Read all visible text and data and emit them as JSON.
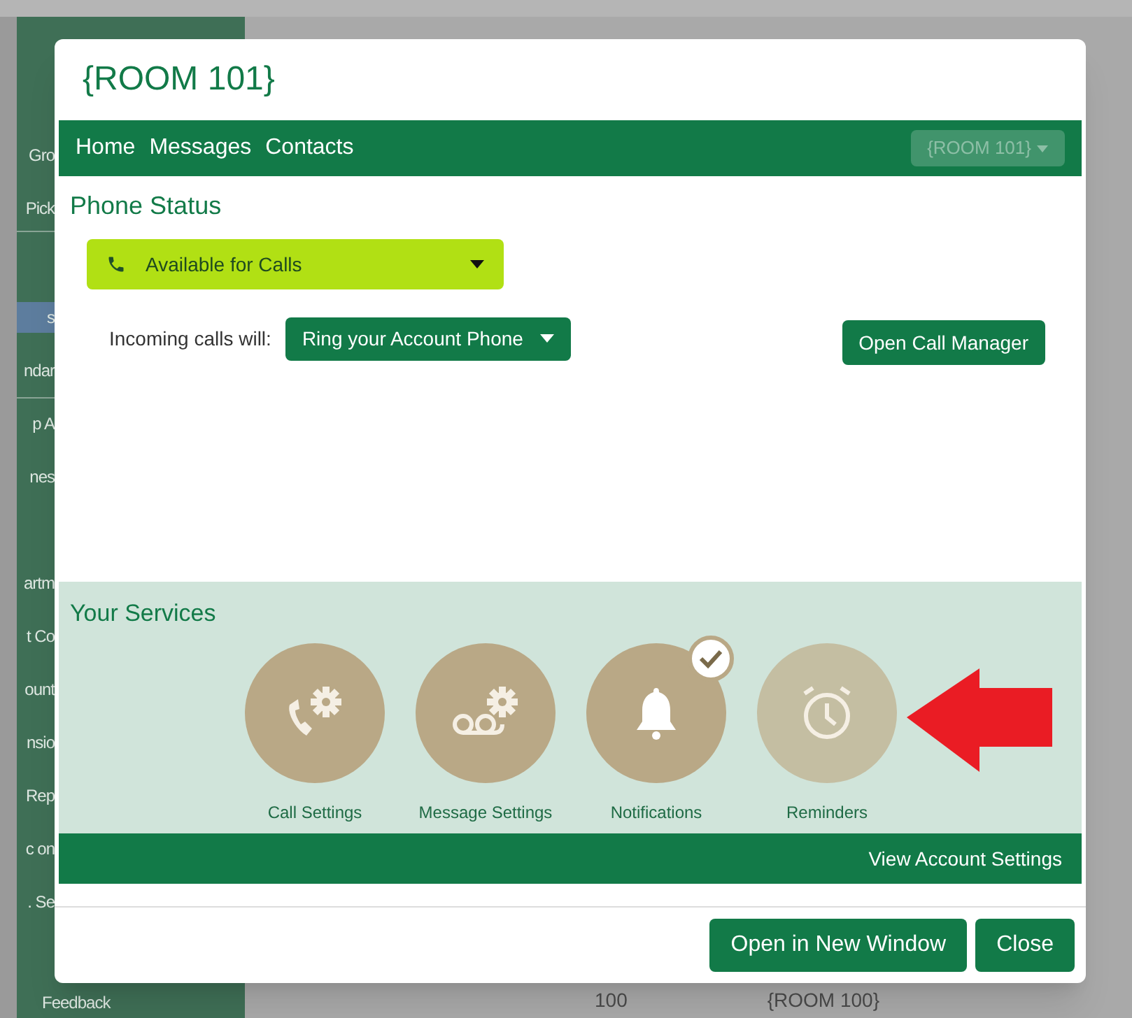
{
  "background": {
    "sidebar_items": [
      {
        "label": "Gro",
        "selected": false
      },
      {
        "label": "Pick",
        "selected": false
      },
      {
        "label": "s",
        "selected": true
      },
      {
        "label": "ndar",
        "selected": false
      },
      {
        "label": "p A",
        "selected": false
      },
      {
        "label": "nes",
        "selected": false
      },
      {
        "label": "artm",
        "selected": false
      },
      {
        "label": "t Co",
        "selected": false
      },
      {
        "label": "ount",
        "selected": false
      },
      {
        "label": "nsio",
        "selected": false
      },
      {
        "label": "Rep",
        "selected": false
      },
      {
        "label": "c on",
        "selected": false
      },
      {
        "label": ". Se",
        "selected": false
      },
      {
        "label": "Feedback",
        "selected": false
      }
    ],
    "row_cells": [
      "100",
      "{ROOM 100}"
    ]
  },
  "dialog": {
    "title": "{ROOM 101}",
    "nav": [
      "Home",
      "Messages",
      "Contacts"
    ],
    "account_menu": {
      "label": "{ROOM 101}",
      "disabled": true
    },
    "phone_status": {
      "heading": "Phone Status",
      "status": "Available for Calls",
      "incoming_label": "Incoming calls will:",
      "incoming_value": "Ring your Account Phone",
      "call_manager_button": "Open Call Manager"
    },
    "services": {
      "heading": "Your Services",
      "items": [
        {
          "label": "Call Settings",
          "checked": false,
          "disabled": false
        },
        {
          "label": "Message Settings",
          "checked": false,
          "disabled": false
        },
        {
          "label": "Notifications",
          "checked": true,
          "disabled": false
        },
        {
          "label": "Reminders",
          "checked": false,
          "disabled": true
        }
      ],
      "footer_link": "View Account Settings"
    },
    "buttons": [
      "Open in New Window",
      "Close"
    ]
  }
}
